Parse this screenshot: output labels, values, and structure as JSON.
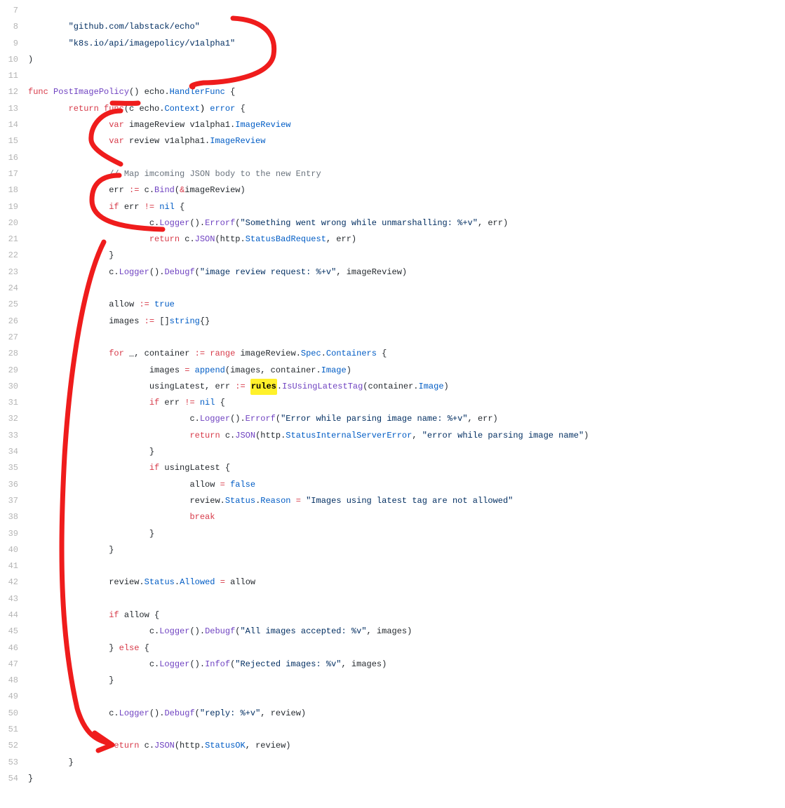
{
  "startLine": 7,
  "highlightWord": "rules",
  "lines": {
    "l7": "",
    "l8a": "        ",
    "l8b": "\"github.com/labstack/echo\"",
    "l9a": "        ",
    "l9b": "\"k8s.io/api/imagepolicy/v1alpha1\"",
    "l10": ")",
    "l11": "",
    "l12_kw": "func",
    "l12_sp": " ",
    "l12_fn": "PostImagePolicy",
    "l12_p": "() echo.",
    "l12_hf": "HandlerFunc",
    "l12_b": " {",
    "l13_i": "        ",
    "l13_kw": "return",
    "l13_sp": " ",
    "l13_kw2": "func",
    "l13_rest": "(c echo.",
    "l13_ctx": "Context",
    "l13_tail": ") ",
    "l13_err": "error",
    "l13_br": " {",
    "l14_i": "                ",
    "l14_kw": "var",
    "l14_rest": " imageReview v1alpha1.",
    "l14_t": "ImageReview",
    "l15_i": "                ",
    "l15_kw": "var",
    "l15_rest": " review v1alpha1.",
    "l15_t": "ImageReview",
    "l16": "",
    "l17_i": "                ",
    "l17_cm": "// Map imcoming JSON body to the new Entry",
    "l18_i": "                ",
    "l18_a": "err ",
    "l18_op": ":=",
    "l18_b": " c.",
    "l18_fn": "Bind",
    "l18_c": "(",
    "l18_amp": "&",
    "l18_d": "imageReview)",
    "l19_i": "                ",
    "l19_kw": "if",
    "l19_a": " err ",
    "l19_op": "!=",
    "l19_sp": " ",
    "l19_nil": "nil",
    "l19_b": " {",
    "l20_i": "                        ",
    "l20_a": "c.",
    "l20_fn1": "Logger",
    "l20_b": "().",
    "l20_fn2": "Errorf",
    "l20_c": "(",
    "l20_str": "\"Something went wrong while unmarshalling: %+v\"",
    "l20_d": ", err)",
    "l21_i": "                        ",
    "l21_kw": "return",
    "l21_a": " c.",
    "l21_fn": "JSON",
    "l21_b": "(http.",
    "l21_st": "StatusBadRequest",
    "l21_c": ", err)",
    "l22_i": "                ",
    "l22_b": "}",
    "l23_i": "                ",
    "l23_a": "c.",
    "l23_fn1": "Logger",
    "l23_b": "().",
    "l23_fn2": "Debugf",
    "l23_c": "(",
    "l23_str": "\"image review request: %+v\"",
    "l23_d": ", imageReview)",
    "l24": "",
    "l25_i": "                ",
    "l25_a": "allow ",
    "l25_op": ":=",
    "l25_sp": " ",
    "l25_v": "true",
    "l26_i": "                ",
    "l26_a": "images ",
    "l26_op": ":=",
    "l26_rest": " []",
    "l26_t": "string",
    "l26_b": "{}",
    "l27": "",
    "l28_i": "                ",
    "l28_kw": "for",
    "l28_a": " _, container ",
    "l28_op": ":=",
    "l28_sp": " ",
    "l28_kw2": "range",
    "l28_b": " imageReview.",
    "l28_p1": "Spec",
    "l28_d": ".",
    "l28_p2": "Containers",
    "l28_br": " {",
    "l29_i": "                        ",
    "l29_a": "images ",
    "l29_op": "=",
    "l29_sp": " ",
    "l29_fn": "append",
    "l29_b": "(images, container.",
    "l29_p": "Image",
    "l29_c": ")",
    "l30_i": "                        ",
    "l30_a": "usingLatest, err ",
    "l30_op": ":=",
    "l30_sp": " ",
    "l30_b": ".",
    "l30_fn": "IsUsingLatestTag",
    "l30_c": "(container.",
    "l30_p": "Image",
    "l30_d": ")",
    "l31_i": "                        ",
    "l31_kw": "if",
    "l31_a": " err ",
    "l31_op": "!=",
    "l31_sp": " ",
    "l31_nil": "nil",
    "l31_b": " {",
    "l32_i": "                                ",
    "l32_a": "c.",
    "l32_fn1": "Logger",
    "l32_b": "().",
    "l32_fn2": "Errorf",
    "l32_c": "(",
    "l32_str": "\"Error while parsing image name: %+v\"",
    "l32_d": ", err)",
    "l33_i": "                                ",
    "l33_kw": "return",
    "l33_a": " c.",
    "l33_fn": "JSON",
    "l33_b": "(http.",
    "l33_st": "StatusInternalServerError",
    "l33_c": ", ",
    "l33_str": "\"error while parsing image name\"",
    "l33_d": ")",
    "l34_i": "                        ",
    "l34_b": "}",
    "l35_i": "                        ",
    "l35_kw": "if",
    "l35_a": " usingLatest {",
    "l36_i": "                                ",
    "l36_a": "allow ",
    "l36_op": "=",
    "l36_sp": " ",
    "l36_v": "false",
    "l37_i": "                                ",
    "l37_a": "review.",
    "l37_p1": "Status",
    "l37_d": ".",
    "l37_p2": "Reason",
    "l37_sp": " ",
    "l37_op": "=",
    "l37_sp2": " ",
    "l37_str": "\"Images using latest tag are not allowed\"",
    "l38_i": "                                ",
    "l38_kw": "break",
    "l39_i": "                        ",
    "l39_b": "}",
    "l40_i": "                ",
    "l40_b": "}",
    "l41": "",
    "l42_i": "                ",
    "l42_a": "review.",
    "l42_p1": "Status",
    "l42_d": ".",
    "l42_p2": "Allowed",
    "l42_sp": " ",
    "l42_op": "=",
    "l42_b": " allow",
    "l43": "",
    "l44_i": "                ",
    "l44_kw": "if",
    "l44_a": " allow {",
    "l45_i": "                        ",
    "l45_a": "c.",
    "l45_fn1": "Logger",
    "l45_b": "().",
    "l45_fn2": "Debugf",
    "l45_c": "(",
    "l45_str": "\"All images accepted: %v\"",
    "l45_d": ", images)",
    "l46_i": "                ",
    "l46_a": "} ",
    "l46_kw": "else",
    "l46_b": " {",
    "l47_i": "                        ",
    "l47_a": "c.",
    "l47_fn1": "Logger",
    "l47_b": "().",
    "l47_fn2": "Infof",
    "l47_c": "(",
    "l47_str": "\"Rejected images: %v\"",
    "l47_d": ", images)",
    "l48_i": "                ",
    "l48_b": "}",
    "l49": "",
    "l50_i": "                ",
    "l50_a": "c.",
    "l50_fn1": "Logger",
    "l50_b": "().",
    "l50_fn2": "Debugf",
    "l50_c": "(",
    "l50_str": "\"reply: %+v\"",
    "l50_d": ", review)",
    "l51": "",
    "l52_i": "                ",
    "l52_kw": "return",
    "l52_a": " c.",
    "l52_fn": "JSON",
    "l52_b": "(http.",
    "l52_st": "StatusOK",
    "l52_c": ", review)",
    "l53_i": "        ",
    "l53_b": "}",
    "l54": "}"
  }
}
